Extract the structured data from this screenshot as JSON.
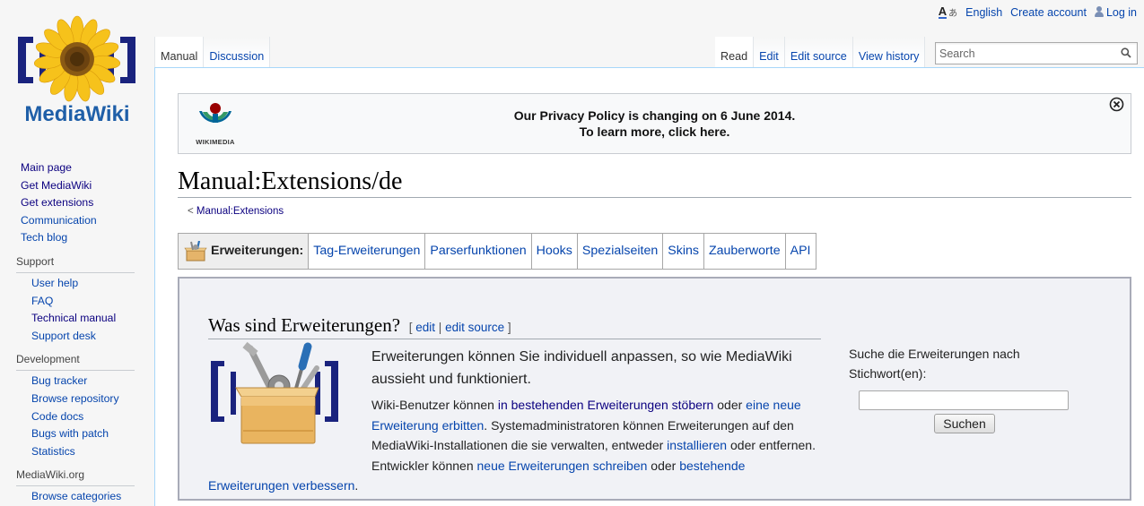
{
  "personal": {
    "language": "English",
    "create_account": "Create account",
    "login": "Log in"
  },
  "logo": {
    "text": "MediaWiki"
  },
  "sidebar": {
    "main": [
      "Main page",
      "Get MediaWiki",
      "Get extensions",
      "Communication",
      "Tech blog"
    ],
    "sections": [
      {
        "heading": "Support",
        "items": [
          "User help",
          "FAQ",
          "Technical manual",
          "Support desk"
        ]
      },
      {
        "heading": "Development",
        "items": [
          "Bug tracker",
          "Browse repository",
          "Code docs",
          "Bugs with patch",
          "Statistics"
        ]
      },
      {
        "heading": "MediaWiki.org",
        "items": [
          "Browse categories"
        ]
      }
    ]
  },
  "tabs": {
    "manual": "Manual",
    "discussion": "Discussion",
    "read": "Read",
    "edit": "Edit",
    "edit_source": "Edit source",
    "view_history": "View history"
  },
  "search": {
    "placeholder": "Search"
  },
  "notice": {
    "logo_text": "WIKIMEDIA",
    "line1": "Our Privacy Policy is changing on 6 June 2014.",
    "line2": "To learn more, click here."
  },
  "page": {
    "title": "Manual:Extensions/de",
    "subpage_arrow": "<",
    "subpage_link": "Manual:Extensions"
  },
  "extnav": {
    "heading": "Erweiterungen:",
    "items": [
      "Tag-Erweiterungen",
      "Parserfunktionen",
      "Hooks",
      "Spezialseiten",
      "Skins",
      "Zauberworte",
      "API"
    ]
  },
  "section": {
    "heading": "Was sind Erweiterungen?",
    "bracket_open": "[",
    "edit": "edit",
    "sep": "|",
    "edit_source": "edit source",
    "bracket_close": "]",
    "lead": "Erweiterungen können Sie individuell anpassen, so wie MediaWiki aussieht und funktioniert.",
    "p1": "Wiki-Benutzer können ",
    "l1": "in bestehenden Erweiterungen stöbern",
    "p2": " oder ",
    "l2": "eine neue Erweiterung erbitten",
    "p3": ". Systemadministratoren können Erweiterungen auf den MediaWiki-Installationen die sie verwalten, entweder ",
    "l3": "installieren",
    "p4": " oder entfernen. Entwickler können ",
    "l4": "neue Erweiterungen schreiben",
    "p5": " oder ",
    "l5": "bestehende Erweiterungen verbessern",
    "p6": "."
  },
  "side_search": {
    "label": "Suche die Erweiterungen nach Stichwort(en):",
    "button": "Suchen"
  }
}
